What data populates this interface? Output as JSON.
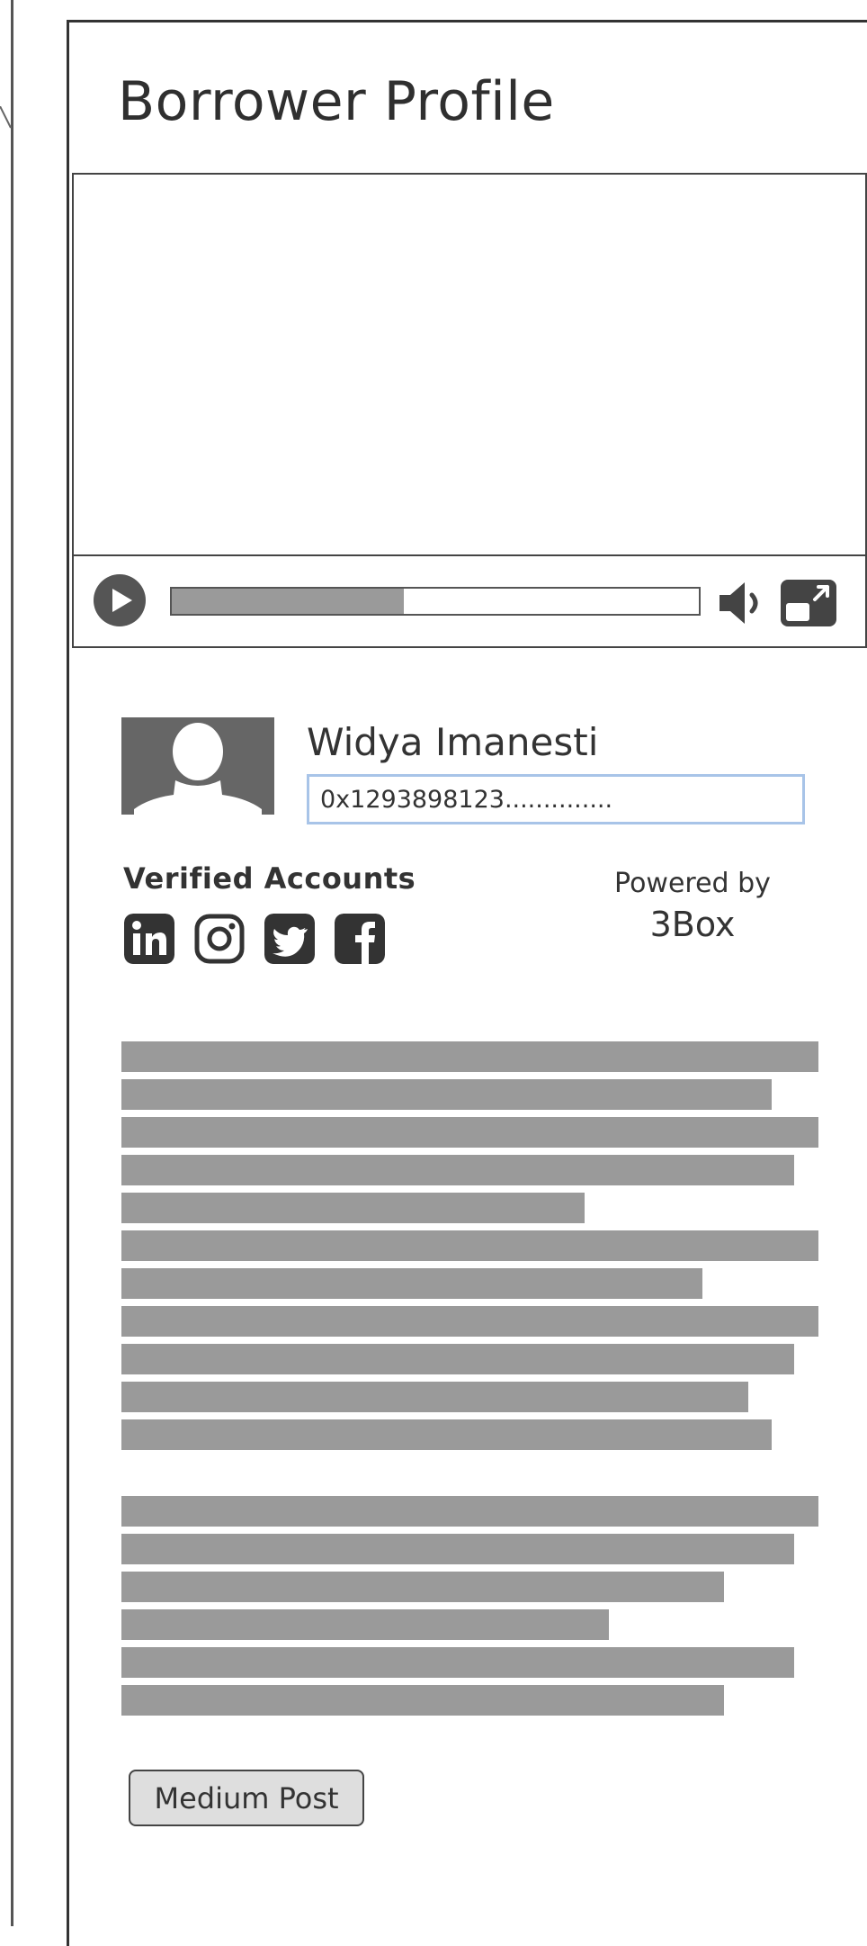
{
  "page": {
    "title": "Borrower Profile"
  },
  "video": {
    "progress_fraction": 0.44
  },
  "profile": {
    "name": "Widya Imanesti",
    "wallet_address": "0x1293898123.............."
  },
  "verified_accounts": {
    "title": "Verified Accounts",
    "icons": [
      "linkedin-icon",
      "instagram-icon",
      "twitter-icon",
      "facebook-icon"
    ]
  },
  "powered_by": {
    "label": "Powered by",
    "brand": "3Box"
  },
  "buttons": {
    "medium_post": "Medium Post"
  },
  "colors": {
    "icon_dark": "#333333",
    "placeholder_gray": "#9a9a9a",
    "field_border": "#a8c4e8",
    "button_bg": "#dedede"
  }
}
